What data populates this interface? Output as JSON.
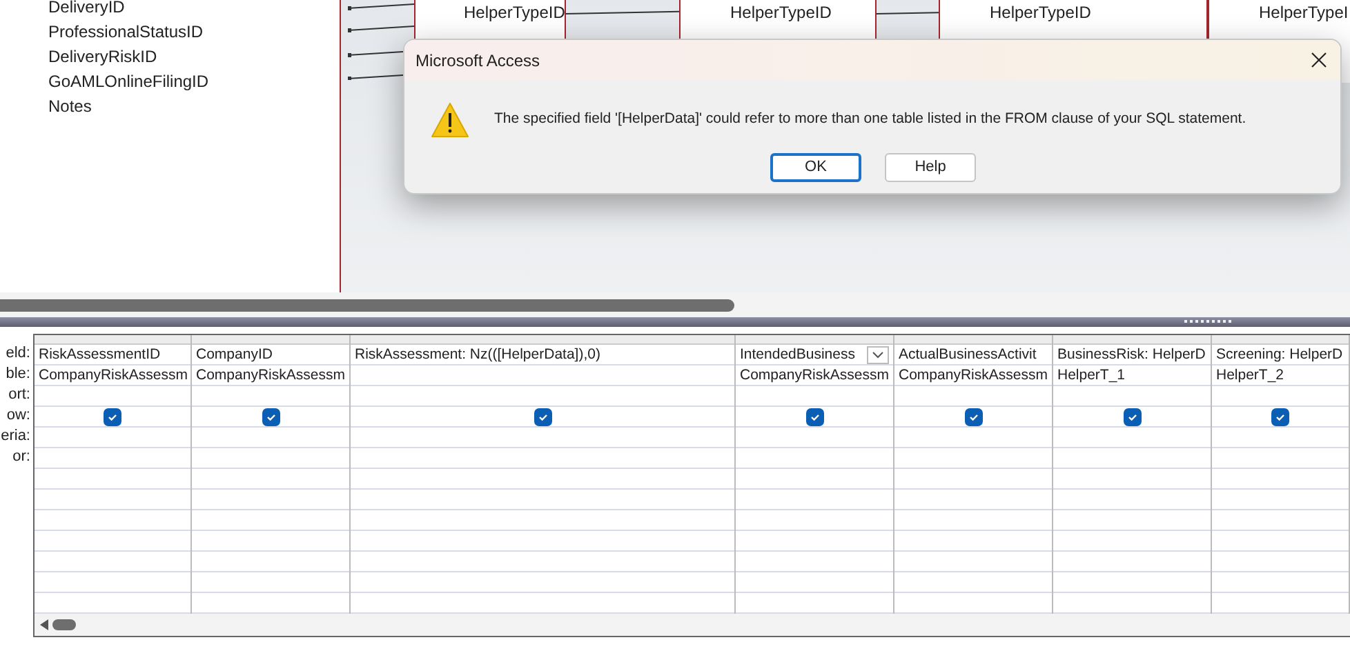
{
  "field_list": [
    "DeliveryID",
    "ProfessionalStatusID",
    "DeliveryRiskID",
    "GoAMLOnlineFilingID",
    "Notes"
  ],
  "tables": [
    {
      "fields": [
        "HelperTypeID"
      ]
    },
    {
      "fields": [
        "HelperTypeID"
      ]
    },
    {
      "fields": [
        "HelperTypeID"
      ]
    },
    {
      "fields": [
        "HelperTypeI"
      ]
    }
  ],
  "dialog": {
    "title": "Microsoft Access",
    "message": "The specified field '[HelperData]' could refer to more than one table listed in the FROM clause of your SQL statement.",
    "buttons": [
      {
        "label": "OK",
        "selected": true
      },
      {
        "label": "Help",
        "selected": false
      }
    ]
  },
  "grid": {
    "row_labels": [
      "eld:",
      "ble:",
      "ort:",
      "ow:",
      "eria:",
      "or:"
    ],
    "columns": [
      {
        "field": "RiskAssessmentID",
        "table": "CompanyRiskAssessm",
        "show": true,
        "dropdown": false
      },
      {
        "field": "CompanyID",
        "table": "CompanyRiskAssessm",
        "show": true,
        "dropdown": false
      },
      {
        "field": "RiskAssessment: Nz(([HelperData]),0)",
        "show": true,
        "dropdown": false
      },
      {
        "field": "IntendedBusiness",
        "table": "CompanyRiskAssessm",
        "show": true,
        "dropdown": true
      },
      {
        "field": "ActualBusinessActivit",
        "table": "CompanyRiskAssessm",
        "show": true,
        "dropdown": false
      },
      {
        "field": "BusinessRisk: HelperD",
        "table": "HelperT_1",
        "show": true,
        "dropdown": false
      },
      {
        "field": "Screening: HelperD",
        "table": "HelperT_2",
        "show": true,
        "dropdown": false
      }
    ]
  }
}
